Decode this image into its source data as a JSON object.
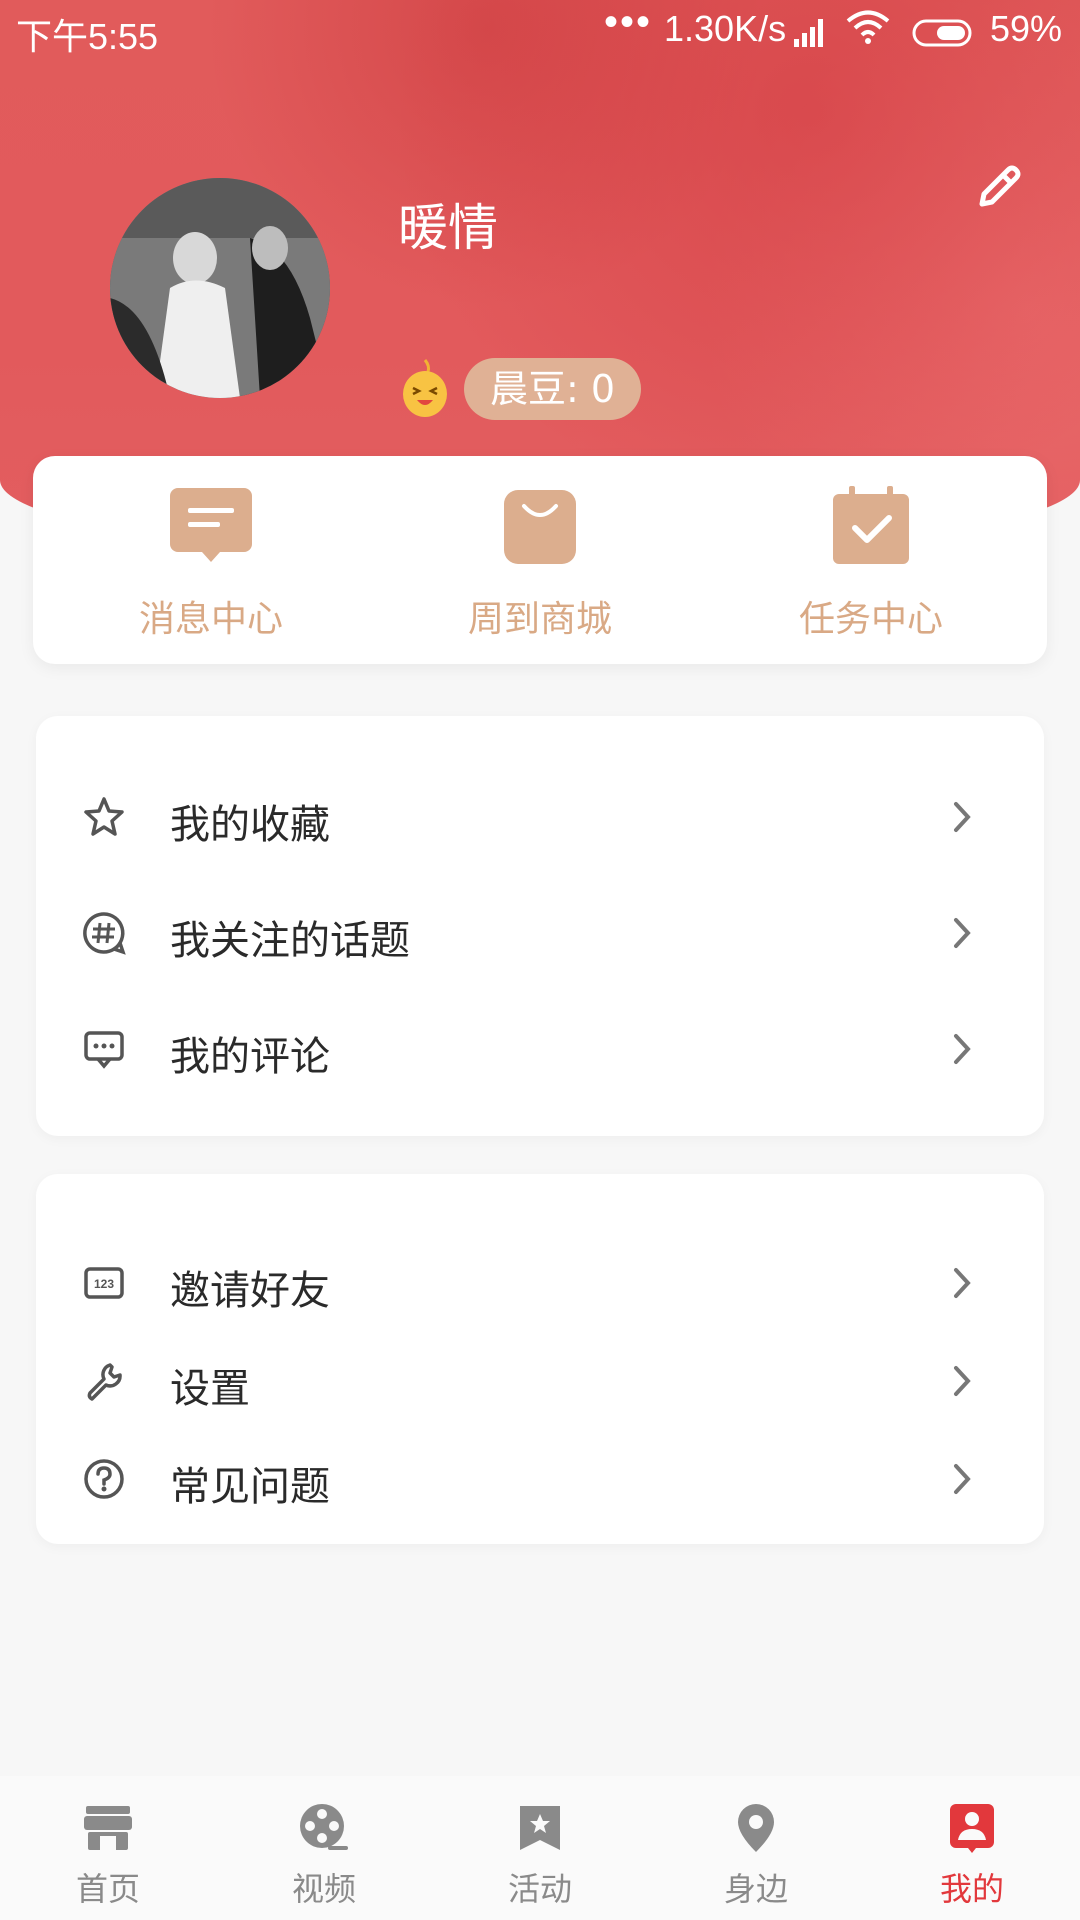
{
  "status_bar": {
    "time": "下午5:55",
    "dots": "•••",
    "speed": "1.30K/s",
    "battery_pct": "59%"
  },
  "profile": {
    "username": "暖情",
    "bean_label": "晨豆: 0"
  },
  "quick_actions": [
    {
      "label": "消息中心",
      "icon": "message-icon"
    },
    {
      "label": "周到商城",
      "icon": "shopping-bag-icon"
    },
    {
      "label": "任务中心",
      "icon": "calendar-check-icon"
    }
  ],
  "menu_group_1": [
    {
      "label": "我的收藏",
      "icon": "star-icon"
    },
    {
      "label": "我关注的话题",
      "icon": "hashtag-icon"
    },
    {
      "label": "我的评论",
      "icon": "comment-icon"
    }
  ],
  "menu_group_2": [
    {
      "label": "邀请好友",
      "icon": "invite-code-icon"
    },
    {
      "label": "设置",
      "icon": "wrench-icon"
    },
    {
      "label": "常见问题",
      "icon": "question-icon"
    }
  ],
  "tabbar": [
    {
      "label": "首页",
      "icon": "store-icon",
      "active": false
    },
    {
      "label": "视频",
      "icon": "film-reel-icon",
      "active": false
    },
    {
      "label": "活动",
      "icon": "bookmark-star-icon",
      "active": false
    },
    {
      "label": "身边",
      "icon": "location-pin-icon",
      "active": false
    },
    {
      "label": "我的",
      "icon": "profile-icon",
      "active": true
    }
  ],
  "colors": {
    "header_red": "#e15b5b",
    "accent_gold": "#d9a985",
    "active_tab": "#e2383c"
  }
}
